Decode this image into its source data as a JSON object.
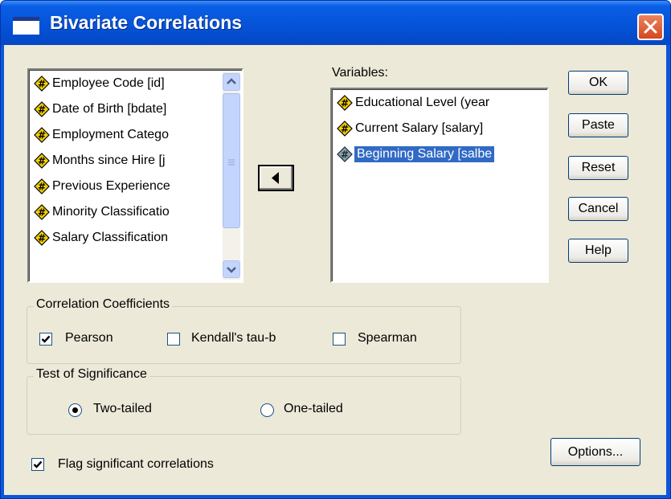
{
  "window": {
    "title": "Bivariate Correlations"
  },
  "source_list": {
    "items": [
      "Employee Code [id]",
      "Date of Birth [bdate]",
      "Employment Catego",
      "Months since Hire [j",
      "Previous Experience",
      "Minority Classificatio",
      "Salary Classification"
    ]
  },
  "variables": {
    "label": "Variables:",
    "items": [
      "Educational Level (year",
      "Current Salary [salary]",
      "Beginning Salary [salbe"
    ],
    "selected": "Beginning Salary [salbe"
  },
  "buttons": {
    "ok": "OK",
    "paste": "Paste",
    "reset": "Reset",
    "cancel": "Cancel",
    "help": "Help",
    "options": "Options..."
  },
  "coefficients": {
    "title": "Correlation Coefficients",
    "pearson": {
      "label": "Pearson",
      "checked": true
    },
    "kendall": {
      "label": "Kendall's tau-b",
      "checked": false
    },
    "spearman": {
      "label": "Spearman",
      "checked": false
    }
  },
  "significance": {
    "title": "Test of Significance",
    "two_tailed": {
      "label": "Two-tailed",
      "selected": true
    },
    "one_tailed": {
      "label": "One-tailed",
      "selected": false
    }
  },
  "flag": {
    "label": "Flag significant correlations",
    "checked": true
  },
  "icons": {
    "variable": "scale-variable-icon",
    "move": "move-arrow-left-icon",
    "close": "close-icon"
  },
  "colors": {
    "titlebar": "#0553d8",
    "dialog_bg": "#ece9d8",
    "selection": "#316ac5",
    "close": "#d5481f"
  }
}
